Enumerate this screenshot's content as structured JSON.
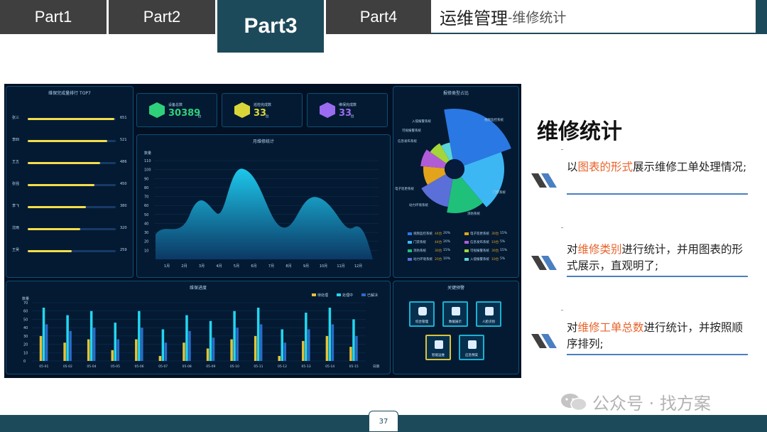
{
  "tabs": [
    {
      "label": "Part1",
      "active": false
    },
    {
      "label": "Part2",
      "active": false
    },
    {
      "label": "Part3",
      "active": true
    },
    {
      "label": "Part4",
      "active": false
    }
  ],
  "header": {
    "title_main": "运维管理",
    "title_sub": "-维修统计"
  },
  "dashboard": {
    "top7": {
      "title": "维保完成量排行 TOP7",
      "rows": [
        {
          "name": "张三",
          "value": 651,
          "fraction": 0.98
        },
        {
          "name": "李四",
          "value": 521,
          "fraction": 0.9
        },
        {
          "name": "王五",
          "value": 486,
          "fraction": 0.82
        },
        {
          "name": "张强",
          "value": 450,
          "fraction": 0.76
        },
        {
          "name": "李飞",
          "value": 380,
          "fraction": 0.66
        },
        {
          "name": "沈雨",
          "value": 320,
          "fraction": 0.6
        },
        {
          "name": "王吴",
          "value": 259,
          "fraction": 0.5
        }
      ]
    },
    "stats": [
      {
        "label": "设备总数",
        "value": "30389",
        "unit": "台",
        "color": "#2fd07a",
        "icon": "device-icon"
      },
      {
        "label": "巡检完成数",
        "value": "33",
        "unit": "台",
        "color": "#d9d63a",
        "icon": "gear-icon"
      },
      {
        "label": "维保完成数",
        "value": "33",
        "unit": "台",
        "color": "#9b6cf0",
        "icon": "tool-icon"
      }
    ],
    "monthly": {
      "title": "月维修统计",
      "ylabel": "数量",
      "yticks": [
        "110",
        "100",
        "90",
        "80",
        "70",
        "60",
        "50",
        "40",
        "30",
        "20",
        "10"
      ],
      "months": [
        "1月",
        "2月",
        "3月",
        "4月",
        "5月",
        "6月",
        "7月",
        "8月",
        "9月",
        "10月",
        "11月",
        "12月"
      ]
    },
    "progress": {
      "title": "维保进度",
      "ylabel": "数量",
      "legend": [
        "待处理",
        "处理中",
        "已解决"
      ],
      "colors": [
        "#e3c33a",
        "#23d6f0",
        "#2a6bc9"
      ],
      "yticks": [
        "70",
        "60",
        "50",
        "40",
        "30",
        "20",
        "10",
        "0"
      ],
      "xlabel": "日期",
      "dates": [
        "05-01",
        "05-02",
        "05-04",
        "05-05",
        "05-06",
        "05-07",
        "05-08",
        "05-09",
        "05-10",
        "05-11",
        "05-12",
        "05-13",
        "05-14",
        "05-15"
      ],
      "pending": [
        30,
        22,
        26,
        13,
        26,
        6,
        22,
        15,
        26,
        30,
        6,
        24,
        30,
        17
      ],
      "processing": [
        64,
        55,
        60,
        46,
        60,
        38,
        55,
        48,
        60,
        64,
        38,
        58,
        64,
        50
      ],
      "resolved": [
        44,
        36,
        40,
        26,
        40,
        22,
        36,
        28,
        40,
        44,
        22,
        38,
        44,
        30
      ]
    },
    "types": {
      "title": "报修类型占比",
      "labels": [
        "视频监控系统",
        "门禁系统",
        "消防系统",
        "动力环境系统",
        "电子巡更系统",
        "信息发布系统",
        "可视报警系统",
        "入侵报警系统"
      ],
      "legend": [
        {
          "name": "视频监控系统",
          "value": "44台",
          "percent": "20%",
          "color": "#2a78e4"
        },
        {
          "name": "电子巡更系统",
          "value": "30台",
          "percent": "15%",
          "color": "#e3a41c"
        },
        {
          "name": "门禁系统",
          "value": "44台",
          "percent": "20%",
          "color": "#3db7f4"
        },
        {
          "name": "信息发布系统",
          "value": "10台",
          "percent": "5%",
          "color": "#b05cd6"
        },
        {
          "name": "消防系统",
          "value": "30台",
          "percent": "15%",
          "color": "#1fc07a"
        },
        {
          "name": "可视报警系统",
          "value": "30台",
          "percent": "15%",
          "color": "#a4d63a"
        },
        {
          "name": "动力环境系统",
          "value": "20台",
          "percent": "10%",
          "color": "#5a6fd8"
        },
        {
          "name": "入侵报警系统",
          "value": "10台",
          "percent": "5%",
          "color": "#5ad6d6"
        }
      ]
    },
    "shortcuts": {
      "title": "关键预警",
      "items": [
        {
          "label": "综合管理",
          "icon": "grid-icon"
        },
        {
          "label": "数据展示",
          "icon": "bar-chart-icon"
        },
        {
          "label": "人脸识别",
          "icon": "camera-icon"
        },
        {
          "label": "智能运维",
          "icon": "target-icon"
        },
        {
          "label": "应急预案",
          "icon": "shield-icon"
        }
      ]
    }
  },
  "content": {
    "heading": "维修统计",
    "items": [
      {
        "pre": "以",
        "hl": "图表的形式",
        "post": "展示维修工单处理情况;"
      },
      {
        "pre": "对",
        "hl": "维修类别",
        "post": "进行统计，并用图表的形式展示，直观明了;"
      },
      {
        "pre": "对",
        "hl": "维修工单总数",
        "post": "进行统计，并按照顺序排列;"
      }
    ]
  },
  "page_number": "37",
  "watermark": "公众号 · 找方案"
}
